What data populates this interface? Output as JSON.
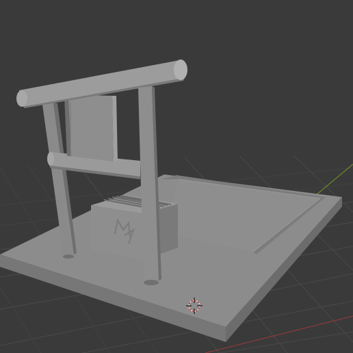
{
  "viewport": {
    "background": "#3a3a3a",
    "grid_color": "#4a4a4a",
    "axis_x_color": "#8a3a3a",
    "axis_y_color": "#6a8a2a"
  },
  "scene": {
    "model_color": "#8a8a8a",
    "model_highlight": "#a6a6a6",
    "model_shadow": "#6e6e6e",
    "base_slab": "base-slab",
    "gate": "torii-gate",
    "box": "offering-box",
    "box_emblem": "emblem-glyph",
    "plaque": "plaque-sign"
  },
  "icons": {
    "origin_cursor": "3d-cursor-icon"
  }
}
